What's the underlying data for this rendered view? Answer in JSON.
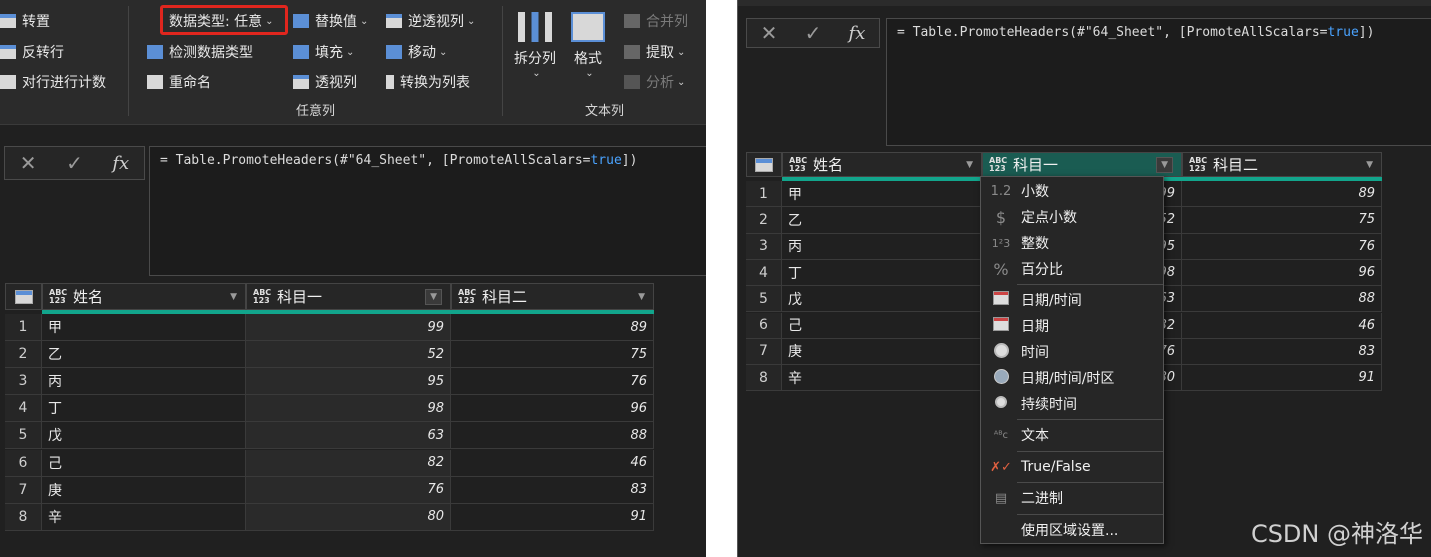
{
  "ribbon": {
    "transform_items": [
      "转置",
      "反转行",
      "对行进行计数"
    ],
    "data_type_label": "数据类型: 任意",
    "detect_type": "检测数据类型",
    "rename": "重命名",
    "replace": "替换值",
    "fill": "填充",
    "pivot": "透视列",
    "unpivot": "逆透视列",
    "move": "移动",
    "to_list": "转换为列表",
    "group_any_col": "任意列",
    "split": "拆分列",
    "format": "格式",
    "merge": "合并列",
    "extract": "提取",
    "analyze": "分析",
    "group_text_col": "文本列"
  },
  "formula": {
    "prefix": "= Table.PromoteHeaders(#\"64_Sheet\", [PromoteAllScalars=",
    "kw": "true",
    "suffix": "])",
    "cancel": "✕",
    "confirm": "✓",
    "fx": "fx"
  },
  "table": {
    "type_badge": "ABC\n123",
    "columns": [
      "姓名",
      "科目一",
      "科目二"
    ],
    "rows": [
      {
        "idx": "1",
        "name": "甲",
        "s1": "99",
        "s2": "89"
      },
      {
        "idx": "2",
        "name": "乙",
        "s1": "52",
        "s2": "75"
      },
      {
        "idx": "3",
        "name": "丙",
        "s1": "95",
        "s2": "76"
      },
      {
        "idx": "4",
        "name": "丁",
        "s1": "98",
        "s2": "96"
      },
      {
        "idx": "5",
        "name": "戊",
        "s1": "63",
        "s2": "88"
      },
      {
        "idx": "6",
        "name": "己",
        "s1": "82",
        "s2": "46"
      },
      {
        "idx": "7",
        "name": "庚",
        "s1": "76",
        "s2": "83"
      },
      {
        "idx": "8",
        "name": "辛",
        "s1": "80",
        "s2": "91"
      }
    ]
  },
  "menu": {
    "items": [
      "小数",
      "定点小数",
      "整数",
      "百分比",
      "日期/时间",
      "日期",
      "时间",
      "日期/时间/时区",
      "持续时间",
      "文本",
      "True/False",
      "二进制",
      "使用区域设置..."
    ],
    "icons": [
      "1.2",
      "$",
      "1²3",
      "%"
    ]
  },
  "watermark": "CSDN @神洛华"
}
